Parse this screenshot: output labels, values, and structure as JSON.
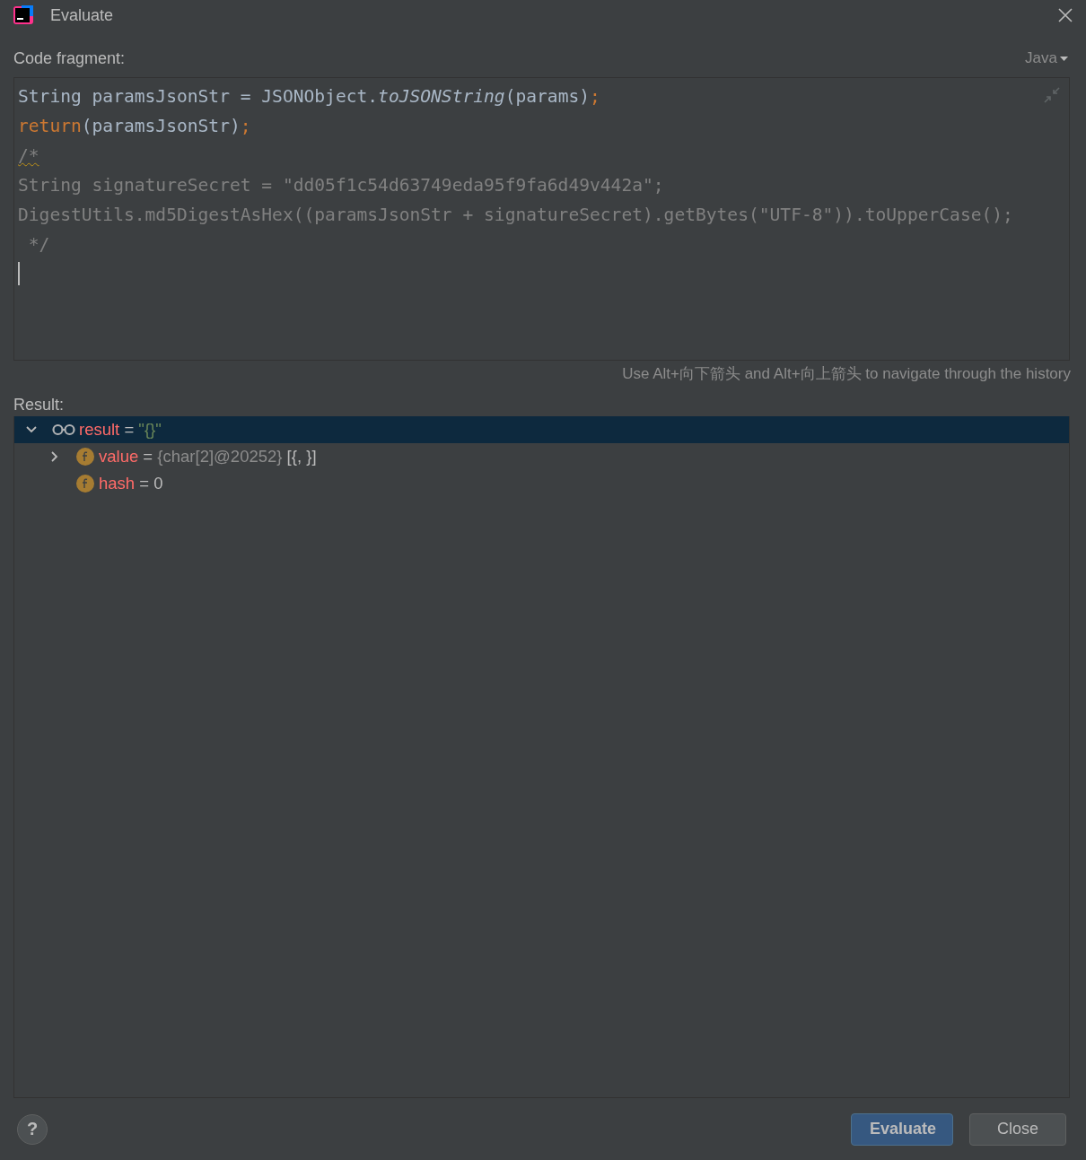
{
  "window": {
    "title": "Evaluate"
  },
  "code_fragment": {
    "label": "Code fragment:",
    "language": "Java",
    "lines": [
      [
        {
          "kind": "plain",
          "text": "String paramsJsonStr = JSONObject."
        },
        {
          "kind": "method",
          "text": "toJSONString"
        },
        {
          "kind": "plain",
          "text": "(params)"
        },
        {
          "kind": "keyword",
          "text": ";"
        }
      ],
      [
        {
          "kind": "keyword",
          "text": "return"
        },
        {
          "kind": "plain",
          "text": "(paramsJsonStr)"
        },
        {
          "kind": "keyword",
          "text": ";"
        }
      ],
      [
        {
          "kind": "warning",
          "text": "/*"
        }
      ],
      [
        {
          "kind": "comment",
          "text": "String signatureSecret = \"dd05f1c54d63749eda95f9fa6d49v442a\";"
        }
      ],
      [
        {
          "kind": "comment",
          "text": "DigestUtils.md5DigestAsHex((paramsJsonStr + signatureSecret).getBytes(\"UTF-8\")).toUpperCase();"
        }
      ],
      [
        {
          "kind": "comment",
          "text": " */"
        }
      ]
    ],
    "hint": "Use Alt+向下箭头 and Alt+向上箭头 to navigate through the history"
  },
  "result": {
    "label": "Result:",
    "tree": [
      {
        "kind": "watch",
        "name": "result",
        "equals": "=",
        "value": [
          {
            "kind": "string",
            "text": "\"{}\""
          }
        ],
        "expanded": true,
        "selected": true,
        "children": [
          {
            "kind": "field",
            "name": "value",
            "equals": "=",
            "value": [
              {
                "kind": "ref",
                "text": "{char[2]@20252}"
              },
              {
                "kind": "plain",
                "text": " [{, }]"
              }
            ],
            "expanded": false,
            "selected": false
          },
          {
            "kind": "field",
            "name": "hash",
            "equals": "=",
            "value": [
              {
                "kind": "plain",
                "text": "0"
              }
            ],
            "selected": false
          }
        ]
      }
    ]
  },
  "help": "?",
  "buttons": [
    {
      "label": "Evaluate",
      "kind": "primary"
    },
    {
      "label": "Close",
      "kind": "secondary"
    }
  ]
}
